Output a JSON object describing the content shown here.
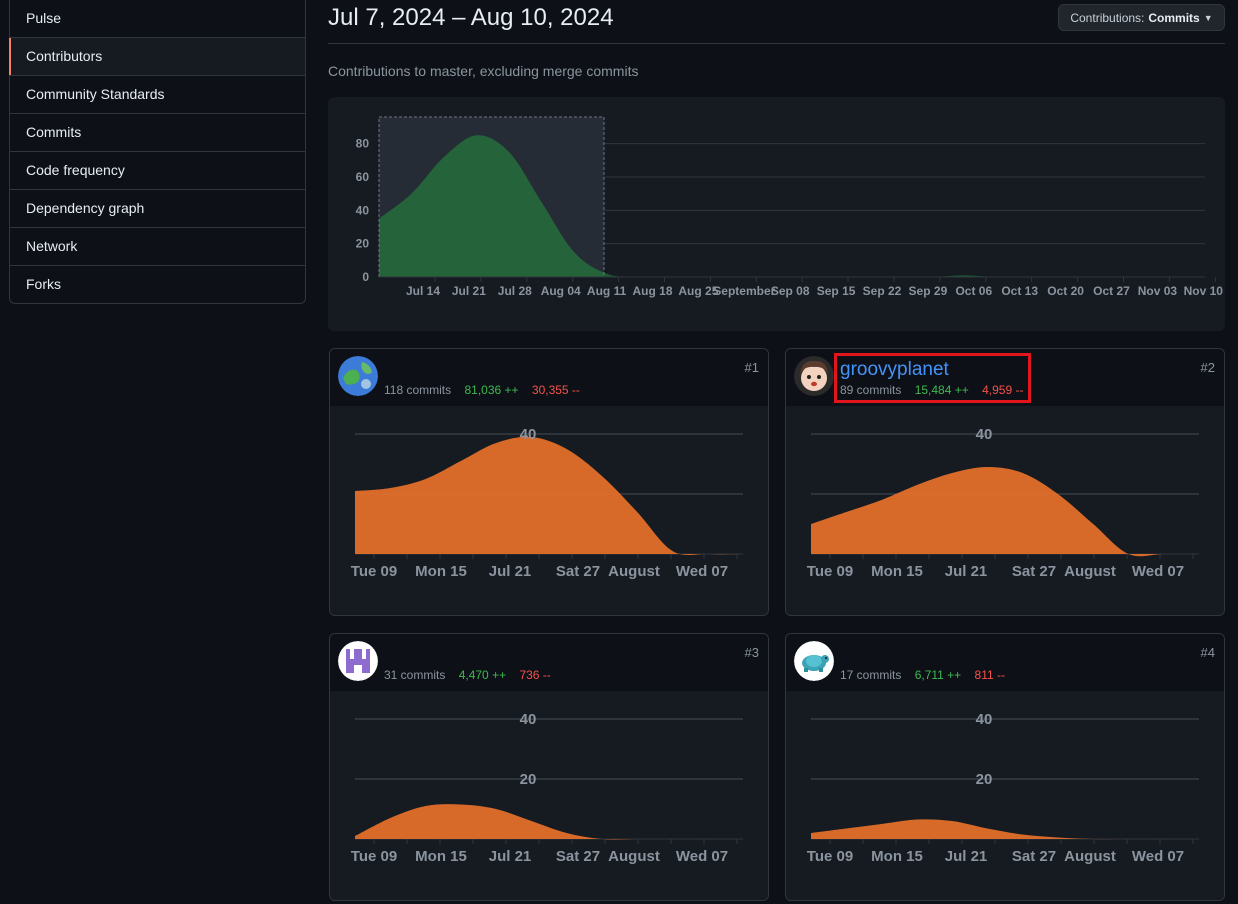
{
  "sidebar": {
    "items": [
      {
        "label": "Pulse"
      },
      {
        "label": "Contributors"
      },
      {
        "label": "Community Standards"
      },
      {
        "label": "Commits"
      },
      {
        "label": "Code frequency"
      },
      {
        "label": "Dependency graph"
      },
      {
        "label": "Network"
      },
      {
        "label": "Forks"
      }
    ],
    "active_index": 1
  },
  "header": {
    "title": "Jul 7, 2024 – Aug 10, 2024",
    "contributions_button": {
      "prefix": "Contributions:",
      "value": "Commits",
      "icon": "caret-down-icon"
    },
    "subtitle": "Contributions to master, excluding merge commits"
  },
  "colors": {
    "accent_active": "#f78166",
    "overview_fill": "#26a641",
    "contributor_fill": "#f0883e",
    "addition": "#3fb950",
    "deletion": "#f85149",
    "username_link": "#4493f8",
    "highlight_box": "#e3151c"
  },
  "chart_data": [
    {
      "type": "area",
      "title": "",
      "x_tick_labels": [
        "Jul 14",
        "Jul 21",
        "Jul 28",
        "Aug 04",
        "Aug 11",
        "Aug 18",
        "Aug 25",
        "September",
        "Sep 08",
        "Sep 15",
        "Sep 22",
        "Sep 29",
        "Oct 06",
        "Oct 13",
        "Oct 20",
        "Oct 27",
        "Nov 03",
        "Nov 10"
      ],
      "y_tick_labels": [
        "0",
        "20",
        "40",
        "60",
        "80"
      ],
      "ylim": [
        0,
        90
      ],
      "series": [
        {
          "values": [
            35,
            50,
            72,
            85,
            75,
            45,
            15,
            2,
            0,
            0,
            0,
            0,
            0,
            0,
            0,
            0,
            0,
            0,
            1,
            0,
            0,
            0,
            0,
            0,
            0
          ]
        }
      ],
      "grid": true,
      "selection": "Jul 7 – Aug 10"
    },
    {
      "type": "area",
      "rank": "#1",
      "commits": "118 commits",
      "additions": "81,036 ++",
      "deletions": "30,355 --",
      "x_tick_labels": [
        "Tue 09",
        "Mon 15",
        "Jul 21",
        "Sat 27",
        "August",
        "Wed 07"
      ],
      "y_tick_labels": [
        "40"
      ],
      "ylim": [
        0,
        40
      ],
      "values": [
        21,
        22,
        25,
        31,
        37,
        39,
        35,
        26,
        14,
        1,
        0,
        0
      ]
    },
    {
      "type": "area",
      "rank": "#2",
      "username": "groovyplanet",
      "commits": "89 commits",
      "additions": "15,484 ++",
      "deletions": "4,959 --",
      "x_tick_labels": [
        "Tue 09",
        "Mon 15",
        "Jul 21",
        "Sat 27",
        "August",
        "Wed 07"
      ],
      "y_tick_labels": [
        "40"
      ],
      "ylim": [
        0,
        40
      ],
      "values": [
        10,
        14,
        18,
        23,
        27,
        29,
        27,
        20,
        10,
        0,
        0,
        0
      ]
    },
    {
      "type": "area",
      "rank": "#3",
      "commits": "31 commits",
      "additions": "4,470 ++",
      "deletions": "736 --",
      "x_tick_labels": [
        "Tue 09",
        "Mon 15",
        "Jul 21",
        "Sat 27",
        "August",
        "Wed 07"
      ],
      "y_tick_labels": [
        "40",
        "20"
      ],
      "ylim": [
        0,
        40
      ],
      "values": [
        1,
        7,
        11,
        11.5,
        10,
        6,
        2,
        0,
        0,
        0,
        0,
        0
      ]
    },
    {
      "type": "area",
      "rank": "#4",
      "commits": "17 commits",
      "additions": "6,711 ++",
      "deletions": "811 --",
      "x_tick_labels": [
        "Tue 09",
        "Mon 15",
        "Jul 21",
        "Sat 27",
        "August",
        "Wed 07"
      ],
      "y_tick_labels": [
        "40",
        "20"
      ],
      "ylim": [
        0,
        40
      ],
      "values": [
        2,
        3.5,
        5,
        6.5,
        6,
        3.5,
        1.5,
        0.5,
        0,
        0,
        0,
        0
      ]
    }
  ]
}
